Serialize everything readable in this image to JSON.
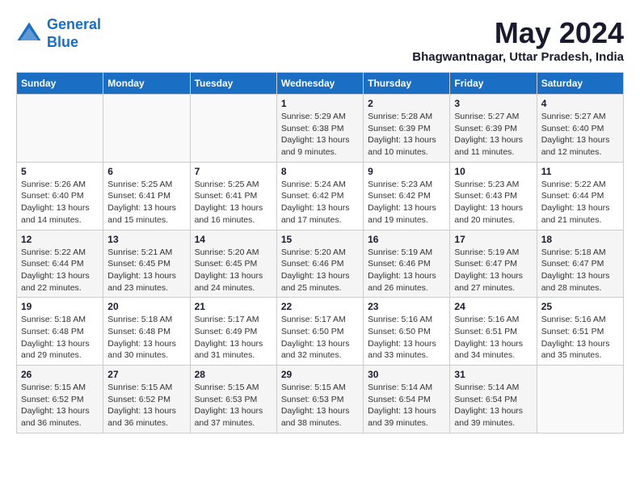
{
  "logo": {
    "line1": "General",
    "line2": "Blue"
  },
  "title": "May 2024",
  "location": "Bhagwantnagar, Uttar Pradesh, India",
  "weekdays": [
    "Sunday",
    "Monday",
    "Tuesday",
    "Wednesday",
    "Thursday",
    "Friday",
    "Saturday"
  ],
  "weeks": [
    [
      {
        "day": "",
        "detail": ""
      },
      {
        "day": "",
        "detail": ""
      },
      {
        "day": "",
        "detail": ""
      },
      {
        "day": "1",
        "detail": "Sunrise: 5:29 AM\nSunset: 6:38 PM\nDaylight: 13 hours\nand 9 minutes."
      },
      {
        "day": "2",
        "detail": "Sunrise: 5:28 AM\nSunset: 6:39 PM\nDaylight: 13 hours\nand 10 minutes."
      },
      {
        "day": "3",
        "detail": "Sunrise: 5:27 AM\nSunset: 6:39 PM\nDaylight: 13 hours\nand 11 minutes."
      },
      {
        "day": "4",
        "detail": "Sunrise: 5:27 AM\nSunset: 6:40 PM\nDaylight: 13 hours\nand 12 minutes."
      }
    ],
    [
      {
        "day": "5",
        "detail": "Sunrise: 5:26 AM\nSunset: 6:40 PM\nDaylight: 13 hours\nand 14 minutes."
      },
      {
        "day": "6",
        "detail": "Sunrise: 5:25 AM\nSunset: 6:41 PM\nDaylight: 13 hours\nand 15 minutes."
      },
      {
        "day": "7",
        "detail": "Sunrise: 5:25 AM\nSunset: 6:41 PM\nDaylight: 13 hours\nand 16 minutes."
      },
      {
        "day": "8",
        "detail": "Sunrise: 5:24 AM\nSunset: 6:42 PM\nDaylight: 13 hours\nand 17 minutes."
      },
      {
        "day": "9",
        "detail": "Sunrise: 5:23 AM\nSunset: 6:42 PM\nDaylight: 13 hours\nand 19 minutes."
      },
      {
        "day": "10",
        "detail": "Sunrise: 5:23 AM\nSunset: 6:43 PM\nDaylight: 13 hours\nand 20 minutes."
      },
      {
        "day": "11",
        "detail": "Sunrise: 5:22 AM\nSunset: 6:44 PM\nDaylight: 13 hours\nand 21 minutes."
      }
    ],
    [
      {
        "day": "12",
        "detail": "Sunrise: 5:22 AM\nSunset: 6:44 PM\nDaylight: 13 hours\nand 22 minutes."
      },
      {
        "day": "13",
        "detail": "Sunrise: 5:21 AM\nSunset: 6:45 PM\nDaylight: 13 hours\nand 23 minutes."
      },
      {
        "day": "14",
        "detail": "Sunrise: 5:20 AM\nSunset: 6:45 PM\nDaylight: 13 hours\nand 24 minutes."
      },
      {
        "day": "15",
        "detail": "Sunrise: 5:20 AM\nSunset: 6:46 PM\nDaylight: 13 hours\nand 25 minutes."
      },
      {
        "day": "16",
        "detail": "Sunrise: 5:19 AM\nSunset: 6:46 PM\nDaylight: 13 hours\nand 26 minutes."
      },
      {
        "day": "17",
        "detail": "Sunrise: 5:19 AM\nSunset: 6:47 PM\nDaylight: 13 hours\nand 27 minutes."
      },
      {
        "day": "18",
        "detail": "Sunrise: 5:18 AM\nSunset: 6:47 PM\nDaylight: 13 hours\nand 28 minutes."
      }
    ],
    [
      {
        "day": "19",
        "detail": "Sunrise: 5:18 AM\nSunset: 6:48 PM\nDaylight: 13 hours\nand 29 minutes."
      },
      {
        "day": "20",
        "detail": "Sunrise: 5:18 AM\nSunset: 6:48 PM\nDaylight: 13 hours\nand 30 minutes."
      },
      {
        "day": "21",
        "detail": "Sunrise: 5:17 AM\nSunset: 6:49 PM\nDaylight: 13 hours\nand 31 minutes."
      },
      {
        "day": "22",
        "detail": "Sunrise: 5:17 AM\nSunset: 6:50 PM\nDaylight: 13 hours\nand 32 minutes."
      },
      {
        "day": "23",
        "detail": "Sunrise: 5:16 AM\nSunset: 6:50 PM\nDaylight: 13 hours\nand 33 minutes."
      },
      {
        "day": "24",
        "detail": "Sunrise: 5:16 AM\nSunset: 6:51 PM\nDaylight: 13 hours\nand 34 minutes."
      },
      {
        "day": "25",
        "detail": "Sunrise: 5:16 AM\nSunset: 6:51 PM\nDaylight: 13 hours\nand 35 minutes."
      }
    ],
    [
      {
        "day": "26",
        "detail": "Sunrise: 5:15 AM\nSunset: 6:52 PM\nDaylight: 13 hours\nand 36 minutes."
      },
      {
        "day": "27",
        "detail": "Sunrise: 5:15 AM\nSunset: 6:52 PM\nDaylight: 13 hours\nand 36 minutes."
      },
      {
        "day": "28",
        "detail": "Sunrise: 5:15 AM\nSunset: 6:53 PM\nDaylight: 13 hours\nand 37 minutes."
      },
      {
        "day": "29",
        "detail": "Sunrise: 5:15 AM\nSunset: 6:53 PM\nDaylight: 13 hours\nand 38 minutes."
      },
      {
        "day": "30",
        "detail": "Sunrise: 5:14 AM\nSunset: 6:54 PM\nDaylight: 13 hours\nand 39 minutes."
      },
      {
        "day": "31",
        "detail": "Sunrise: 5:14 AM\nSunset: 6:54 PM\nDaylight: 13 hours\nand 39 minutes."
      },
      {
        "day": "",
        "detail": ""
      }
    ]
  ]
}
